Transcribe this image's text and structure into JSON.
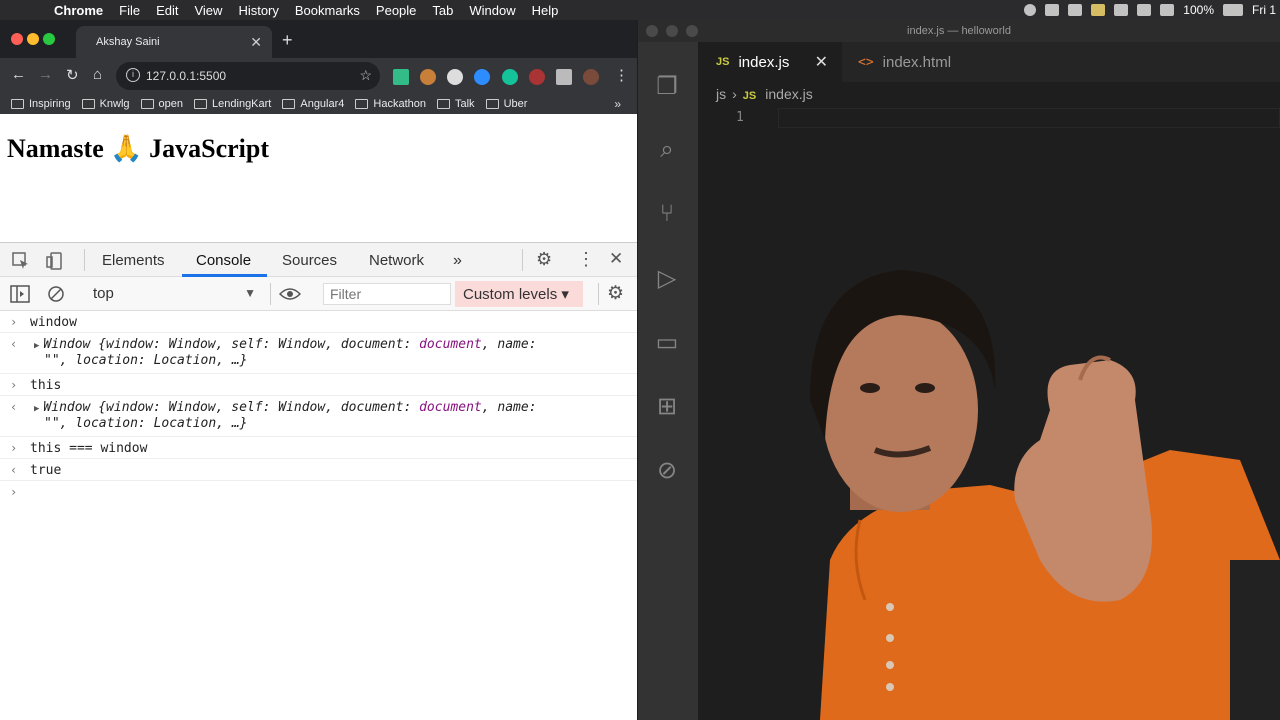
{
  "menubar": {
    "app": "Chrome",
    "items": [
      "File",
      "Edit",
      "View",
      "History",
      "Bookmarks",
      "People",
      "Tab",
      "Window",
      "Help"
    ],
    "battery": "100%",
    "clock": "Fri 1"
  },
  "chrome": {
    "tab_title": "Akshay Saini",
    "url": "127.0.0.1:5500",
    "bookmarks": [
      "Inspiring",
      "Knwlg",
      "open",
      "LendingKart",
      "Angular4",
      "Hackathon",
      "Talk",
      "Uber"
    ],
    "page_heading": "Namaste 🙏 JavaScript"
  },
  "devtools": {
    "tabs": [
      "Elements",
      "Console",
      "Sources",
      "Network"
    ],
    "more": "»",
    "context": "top",
    "filter_placeholder": "Filter",
    "levels": "Custom levels ▾",
    "console": [
      {
        "type": "input",
        "text": "window"
      },
      {
        "type": "output",
        "line1": "Window {window: Window, self: Window, document: ",
        "doc": "document",
        "line1b": ", name:",
        "line2": "\"\", location: Location, …}"
      },
      {
        "type": "input",
        "text": "this"
      },
      {
        "type": "output",
        "line1": "Window {window: Window, self: Window, document: ",
        "doc": "document",
        "line1b": ", name:",
        "line2": "\"\", location: Location, …}"
      },
      {
        "type": "input",
        "text": "this === window"
      },
      {
        "type": "result",
        "text": "true"
      }
    ]
  },
  "vscode": {
    "title": "index.js — helloworld",
    "tabs": [
      {
        "label": "index.js",
        "active": true
      },
      {
        "label": "index.html",
        "active": false
      }
    ],
    "breadcrumb": [
      "js",
      "index.js"
    ],
    "line_number": "1"
  }
}
